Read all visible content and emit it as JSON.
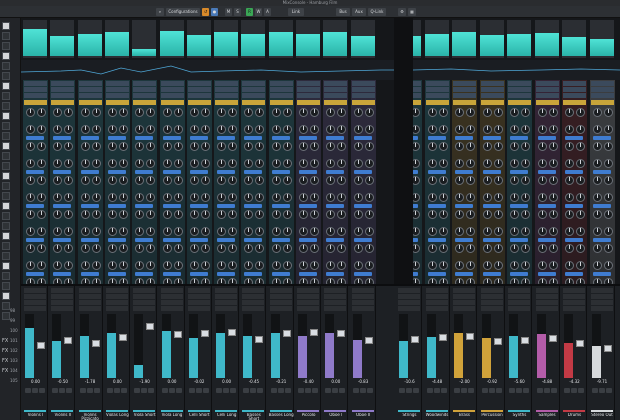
{
  "window": {
    "title": "MixConsole - Hamburg Film"
  },
  "toolbar": {
    "configurations_label": "Configurations",
    "btn_m": "M",
    "btn_s": "S",
    "btn_w": "W",
    "btn_r": "R",
    "btn_a": "A",
    "btn_link": "Link",
    "btn_bus": "Bus",
    "btn_aux": "Aux",
    "btn_qlink": "Q-Link"
  },
  "sidebar": {
    "fx_labels": [
      "FX",
      "FX",
      "FX",
      "FX"
    ],
    "numbers": [
      "98",
      "99",
      "100",
      "101",
      "102",
      "103",
      "104",
      "105"
    ]
  },
  "channels": [
    {
      "name": "Violins I",
      "value": "0.00",
      "color": "#3fb8c9",
      "level": 0.78,
      "fader": 0.52
    },
    {
      "name": "Violins II",
      "value": "-0.50",
      "color": "#3fb8c9",
      "level": 0.58,
      "fader": 0.6
    },
    {
      "name": "Violins Pizzicato",
      "value": "-1.78",
      "color": "#3fb8c9",
      "level": 0.66,
      "fader": 0.56
    },
    {
      "name": "Violas Long",
      "value": "0.00",
      "color": "#3fb8c9",
      "level": 0.7,
      "fader": 0.66
    },
    {
      "name": "Viola Short",
      "value": "-1.90",
      "color": "#3fb8c9",
      "level": 0.2,
      "fader": 0.84
    },
    {
      "name": "Viola Long",
      "value": "0.00",
      "color": "#3fb8c9",
      "level": 0.74,
      "fader": 0.7
    },
    {
      "name": "Celli Short",
      "value": "-0.02",
      "color": "#3fb8c9",
      "level": 0.62,
      "fader": 0.73
    },
    {
      "name": "Celli Long",
      "value": "0.00",
      "color": "#3fb8c9",
      "level": 0.7,
      "fader": 0.74
    },
    {
      "name": "Basses Short",
      "value": "-0.45",
      "color": "#3fb8c9",
      "level": 0.66,
      "fader": 0.62
    },
    {
      "name": "Basses Long",
      "value": "-0.21",
      "color": "#3fb8c9",
      "level": 0.7,
      "fader": 0.72
    },
    {
      "name": "Piccolo",
      "value": "-0.40",
      "color": "#8f7ac9",
      "level": 0.66,
      "fader": 0.74
    },
    {
      "name": "Oboe I",
      "value": "0.00",
      "color": "#8f7ac9",
      "level": 0.7,
      "fader": 0.72
    },
    {
      "name": "Oboe II",
      "value": "-0.83",
      "color": "#8f7ac9",
      "level": 0.6,
      "fader": 0.6
    },
    {
      "name": "Strings",
      "value": "-10.6",
      "color": "#3fb8c9",
      "level": 0.58,
      "fader": 0.62
    },
    {
      "name": "Woodwinds",
      "value": "-4.48",
      "color": "#3fb8c9",
      "level": 0.64,
      "fader": 0.66
    },
    {
      "name": "Brass",
      "value": "-2.00",
      "color": "#d0a23a",
      "level": 0.7,
      "fader": 0.68
    },
    {
      "name": "Percussion",
      "value": "-0.92",
      "color": "#d0a23a",
      "level": 0.62,
      "fader": 0.58
    },
    {
      "name": "Synths",
      "value": "-5.60",
      "color": "#3fb8c9",
      "level": 0.66,
      "fader": 0.6
    },
    {
      "name": "Samples",
      "value": "-4.88",
      "color": "#b35ca8",
      "level": 0.68,
      "fader": 0.64
    },
    {
      "name": "Drums",
      "value": "-4.32",
      "color": "#c23a45",
      "level": 0.55,
      "fader": 0.55
    },
    {
      "name": "Stereo Out",
      "value": "-9.71",
      "color": "#d6d9dc",
      "level": 0.5,
      "fader": 0.46
    }
  ]
}
